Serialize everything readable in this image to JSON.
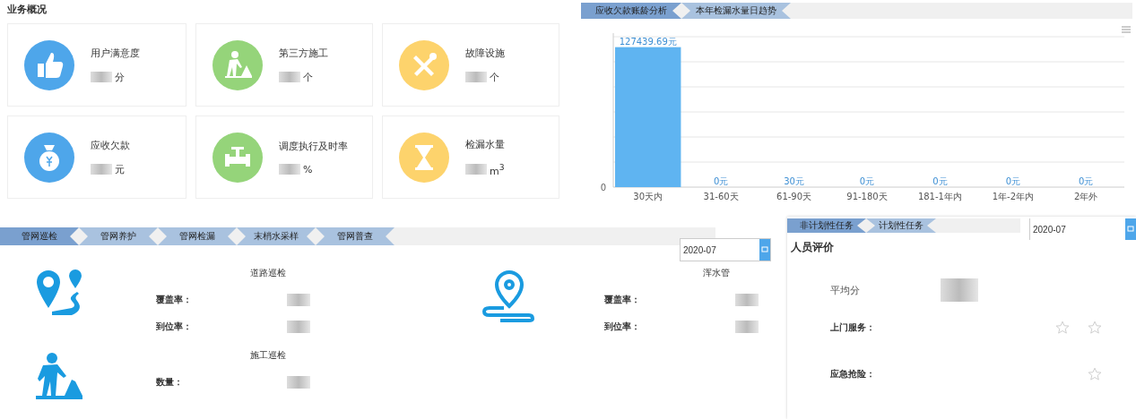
{
  "overview": {
    "title": "业务概况",
    "cards": [
      {
        "label": "用户满意度",
        "unit": "分",
        "kind": "thumb",
        "color": "#4ea6ea"
      },
      {
        "label": "第三方施工",
        "unit": "个",
        "kind": "worker",
        "color": "#95d47a"
      },
      {
        "label": "故障设施",
        "unit": "个",
        "kind": "tools",
        "color": "#fdd36c"
      },
      {
        "label": "应收欠款",
        "unit": "元",
        "kind": "moneybag",
        "color": "#4ea6ea"
      },
      {
        "label": "调度执行及时率",
        "unit": "%",
        "kind": "valve",
        "color": "#95d47a"
      },
      {
        "label": "检漏水量",
        "unit": "m$^{3}$",
        "kind": "hourglass",
        "color": "#fdd36c"
      }
    ]
  },
  "chart_panel": {
    "tabs": [
      {
        "label": "应收欠款账龄分析",
        "selected": true
      },
      {
        "label": "本年检漏水量日趋势",
        "selected": false
      }
    ],
    "axis_zero_label": "0",
    "chart_data": {
      "type": "bar",
      "categories": [
        "30天内",
        "31-60天",
        "61-90天",
        "91-180天",
        "181-1年内",
        "1年-2年内",
        "2年外"
      ],
      "values": [
        127439.69,
        0,
        30,
        0,
        0,
        0,
        0
      ],
      "data_labels": true,
      "value_labels": [
        "127439.69元",
        "0元",
        "30元",
        "0元",
        "0元",
        "0元",
        "0元"
      ]
    }
  },
  "patrol": {
    "tabs": [
      {
        "label": "管网巡检",
        "selected": true
      },
      {
        "label": "管网养护",
        "selected": false
      },
      {
        "label": "管网检漏",
        "selected": false
      },
      {
        "label": "末梢水采样",
        "selected": false
      },
      {
        "label": "管网普查",
        "selected": false
      }
    ],
    "date": "2020-07",
    "sections": [
      {
        "title": "道路巡检",
        "kind": "route",
        "fields": [
          "覆盖率：",
          "到位率："
        ]
      },
      {
        "title": "浑水管",
        "kind": "pinpath",
        "fields": [
          "覆盖率：",
          "到位率："
        ]
      },
      {
        "title": "施工巡检",
        "kind": "worker",
        "fields": [
          "数量："
        ]
      }
    ]
  },
  "evaluation": {
    "tabs": [
      {
        "label": "非计划性任务",
        "selected": true
      },
      {
        "label": "计划性任务",
        "selected": false
      }
    ],
    "date": "2020-07",
    "title": "人员评价",
    "average_label": "平均分",
    "ratings": [
      {
        "label": "上门服务：",
        "stars": [
          {
            "filled": false
          },
          {
            "filled": false
          }
        ]
      },
      {
        "label": "应急抢险：",
        "stars": [
          {
            "filled": false
          }
        ]
      }
    ]
  }
}
